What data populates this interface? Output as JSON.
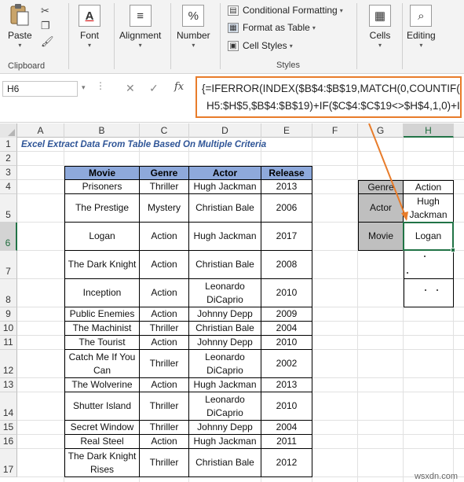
{
  "ribbon": {
    "clipboard": {
      "paste": "Paste",
      "group": "Clipboard"
    },
    "font": {
      "label": "Font"
    },
    "alignment": {
      "label": "Alignment"
    },
    "number": {
      "label": "Number",
      "icon_text": "%"
    },
    "styles": {
      "items": [
        "Conditional Formatting",
        "Format as Table",
        "Cell Styles"
      ],
      "group": "Styles"
    },
    "cells": {
      "label": "Cells"
    },
    "editing": {
      "label": "Editing"
    }
  },
  "formula_bar": {
    "name_box": "H6",
    "fx": "fx",
    "line1": "{=IFERROR(INDEX($B$4:$B$19,MATCH(0,COUNTIF(",
    "line2": "H5:$H$5,$B$4:$B$19)+IF($C$4:$C$19<>$H$4,1,0)+IF("
  },
  "columns": [
    "A",
    "B",
    "C",
    "D",
    "E",
    "F",
    "G",
    "H"
  ],
  "rows": [
    "1",
    "2",
    "3",
    "4",
    "5",
    "6",
    "7",
    "8",
    "9",
    "10",
    "11",
    "12",
    "13",
    "14",
    "15",
    "16",
    "17"
  ],
  "sheet": {
    "title": "Excel Extract Data From Table Based On Multiple Criteria",
    "headers": [
      "Movie",
      "Genre",
      "Actor",
      "Release"
    ],
    "table": [
      [
        "Prisoners",
        "Thriller",
        "Hugh Jackman",
        "2013"
      ],
      [
        "The Prestige",
        "Mystery",
        "Christian Bale",
        "2006"
      ],
      [
        "Logan",
        "Action",
        "Hugh Jackman",
        "2017"
      ],
      [
        "The Dark Knight",
        "Action",
        "Christian Bale",
        "2008"
      ],
      [
        "Inception",
        "Action",
        "Leonardo\nDiCaprio",
        "2010"
      ],
      [
        "Public Enemies",
        "Action",
        "Johnny Depp",
        "2009"
      ],
      [
        "The Machinist",
        "Thriller",
        "Christian Bale",
        "2004"
      ],
      [
        "The Tourist",
        "Action",
        "Johnny Depp",
        "2010"
      ],
      [
        "Catch Me If You\nCan",
        "Thriller",
        "Leonardo\nDiCaprio",
        "2002"
      ],
      [
        "The Wolverine",
        "Action",
        "Hugh Jackman",
        "2013"
      ],
      [
        "Shutter Island",
        "Thriller",
        "Leonardo\nDiCaprio",
        "2010"
      ],
      [
        "Secret Window",
        "Thriller",
        "Johnny Depp",
        "2004"
      ],
      [
        "Real Steel",
        "Action",
        "Hugh Jackman",
        "2011"
      ],
      [
        "The Dark Knight\nRises",
        "Thriller",
        "Christian Bale",
        "2012"
      ]
    ],
    "criteria": [
      {
        "label": "Genre",
        "value": "Action"
      },
      {
        "label": "Actor",
        "value": "Hugh\nJackman"
      },
      {
        "label": "Movie",
        "value": "Logan"
      }
    ]
  },
  "watermark": "wsxdn.com",
  "colors": {
    "header_fill": "#8ea9db",
    "label_fill": "#bfbfbf",
    "title": "#2f5597",
    "arrow": "#e87c2a",
    "selection": "#217346"
  }
}
